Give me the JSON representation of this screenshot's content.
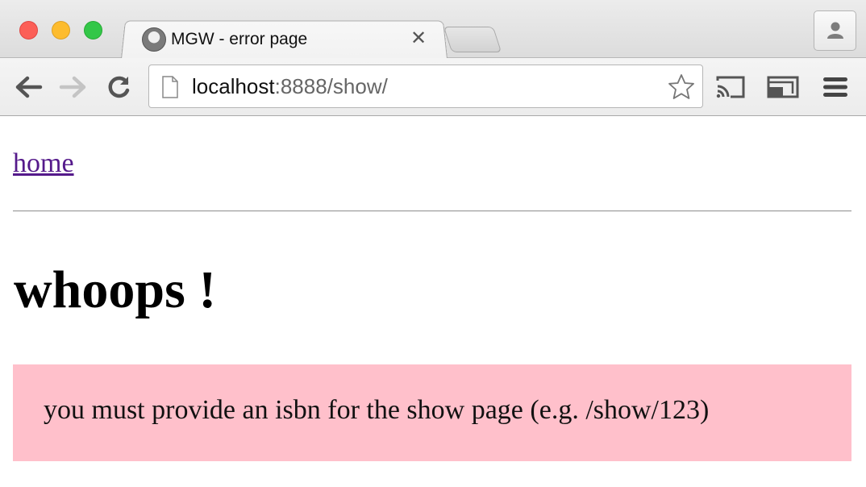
{
  "browser": {
    "tab": {
      "title": "MGW - error page",
      "close_glyph": "✕",
      "favicon": "site-logo-icon"
    },
    "address": {
      "host": "localhost",
      "rest": ":8888/show/"
    },
    "colors": {
      "link": "#551a8b",
      "error_bg": "#ffc0cb"
    }
  },
  "page": {
    "nav_link": "home",
    "heading": "whoops !",
    "error_message": "you must provide an isbn for the show page (e.g. /show/123)"
  }
}
